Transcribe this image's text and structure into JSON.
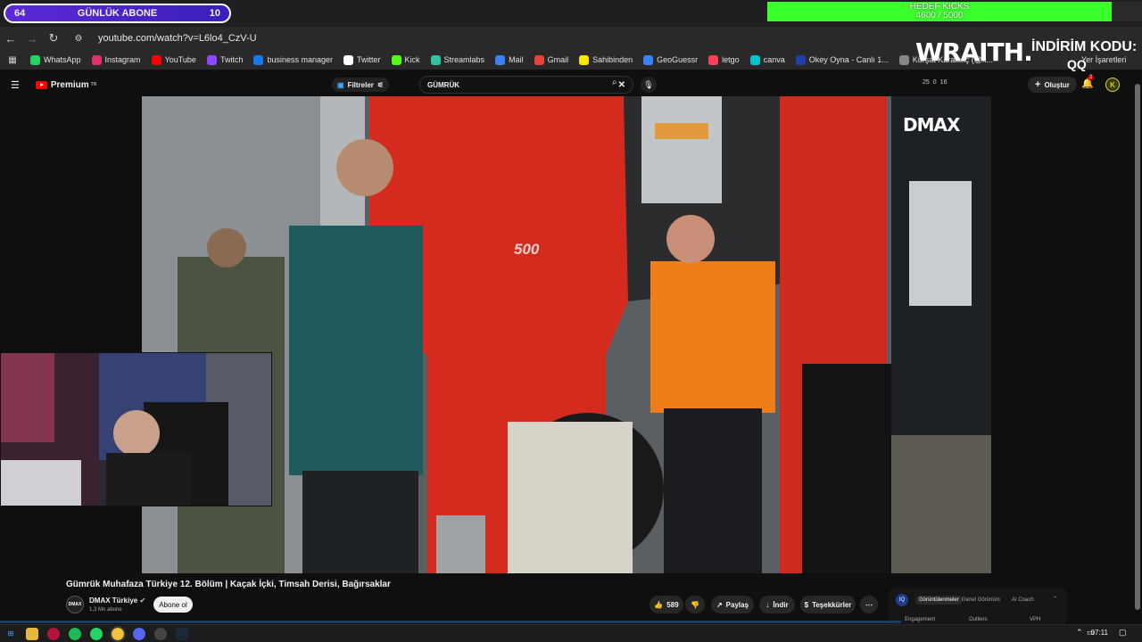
{
  "overlay": {
    "sub_left": "64",
    "sub_label": "GÜNLÜK ABONE",
    "sub_right": "10",
    "goal_title": "HEDEF KICKS",
    "goal_value": "4600 / 5000",
    "goal_fraction": 0.92
  },
  "sponsor": {
    "logo": "WRAITH.",
    "code_label": "İNDİRİM KODU:",
    "code_value": "QQ"
  },
  "browser": {
    "url": "youtube.com/watch?v=L6lo4_CzV-U",
    "bookmarks": [
      "WhatsApp",
      "Instagram",
      "YouTube",
      "Twitch",
      "business manager",
      "Twitter",
      "Kick",
      "Streamlabs",
      "Mail",
      "Gmail",
      "Sahibinden",
      "GeoGuessr",
      "letgo",
      "canva",
      "Okey Oyna - Canlı 1...",
      "Kürşat Karakılıç (@k..."
    ],
    "bookmark_colors": [
      "#25d366",
      "#e1306c",
      "#ff0000",
      "#9146ff",
      "#1877f2",
      "#ffffff",
      "#53fc18",
      "#31c3a2",
      "#3b82f6",
      "#ea4335",
      "#ffe800",
      "#3b82f6",
      "#ff3f55",
      "#00c4cc",
      "#1e40af",
      "#888888"
    ],
    "bookmarks_right": "Yer İşaretleri"
  },
  "youtube": {
    "logo_text": "Premium",
    "logo_sup": "TR",
    "filters_label": "Filtreler",
    "search_value": "GÜMRÜK",
    "ext_stats": [
      "25",
      "0",
      "16"
    ],
    "create_label": "Oluştur",
    "notif_count": "2",
    "avatar_letter": "K"
  },
  "video": {
    "watermark": "DMAX",
    "truck_badge": "500",
    "title": "Gümrük Muhafaza Türkiye 12. Bölüm | Kaçak İçki, Timsah Derisi, Bağırsaklar",
    "channel_name": "DMAX Türkiye",
    "channel_avatar_text": "DMAX",
    "channel_subs": "1,3 Mn abone",
    "subscribe_label": "Abone ol",
    "likes": "589",
    "share_label": "Paylaş",
    "download_label": "İndir",
    "thanks_label": "Teşekkürler"
  },
  "ext_panel": {
    "tabs": [
      "Görüntülenmeler",
      "Genel Görünüm",
      "AI Coach"
    ],
    "cols": [
      "Engagement",
      "Outliers",
      "VPH"
    ]
  },
  "taskbar": {
    "time": "07:11"
  }
}
